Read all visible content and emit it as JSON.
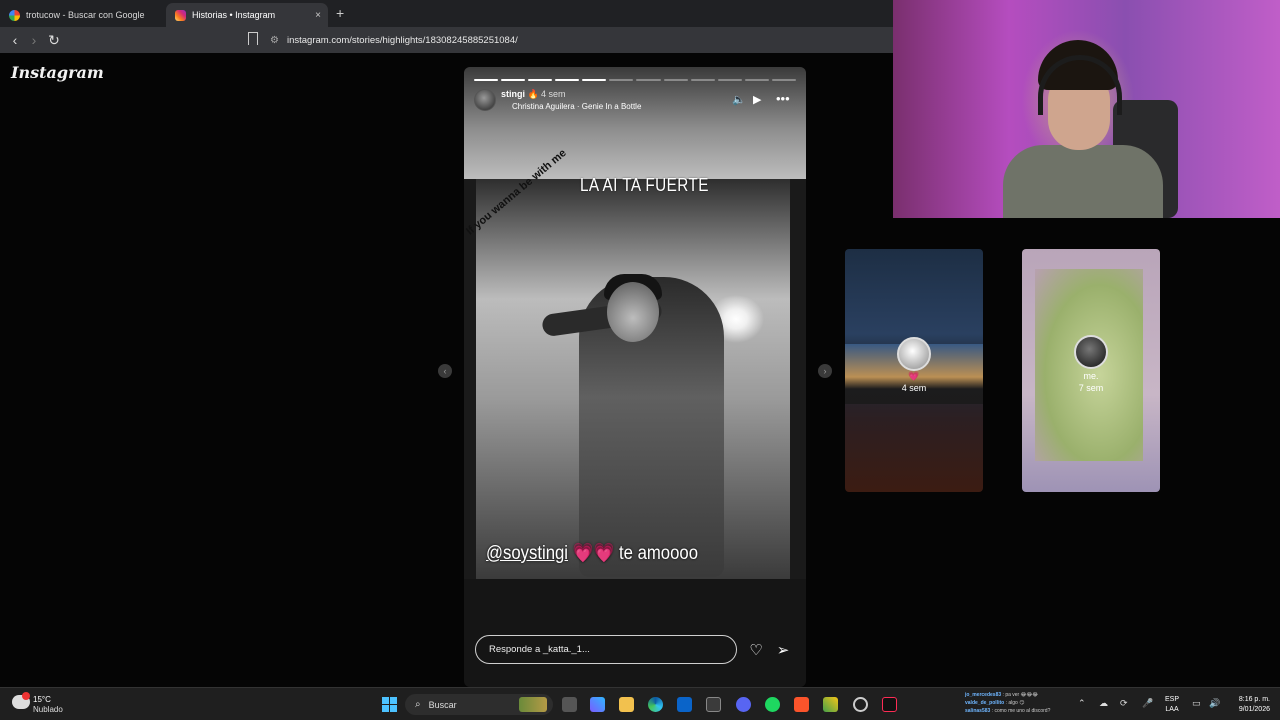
{
  "browser": {
    "tabs": [
      {
        "label": "trotucow - Buscar con Google",
        "favicon": "google-icon"
      },
      {
        "label": "Historias • Instagram",
        "favicon": "instagram-icon",
        "active": true
      }
    ],
    "new_tab": "+",
    "close": "×",
    "url": "instagram.com/stories/highlights/18308245885251084/"
  },
  "instagram": {
    "logo": "Instagram",
    "story": {
      "username": "stingi",
      "time": "4 sem",
      "song": "Christina Aguilera · Genie In a Bottle",
      "segments_total": 12,
      "segments_done": 5,
      "caption_top": "LA AI TA FUERTE",
      "caption_diagonal": "If you wanna be with me",
      "caption_mention": "@soystingi",
      "caption_hearts": "💗💗",
      "caption_end": "te amoooo",
      "reply_placeholder": "Responde a _katta._1..."
    },
    "previews": [
      {
        "label": "4 sem",
        "name": ""
      },
      {
        "label": "7 sem",
        "name": "me."
      }
    ]
  },
  "taskbar": {
    "weather_temp": "15°C",
    "weather_cond": "Nublado",
    "search": "Buscar",
    "chat": [
      {
        "user": "jo_mercedes83",
        "msg": "pa ver 😂😂😂"
      },
      {
        "user": "valde_de_pollito",
        "msg": "algo 😏"
      },
      {
        "user": "salinas583",
        "msg": "como me uno al discord?"
      }
    ],
    "lang_1": "ESP",
    "lang_2": "LAA",
    "time": "8:16 p. m.",
    "date": "9/01/2026"
  }
}
